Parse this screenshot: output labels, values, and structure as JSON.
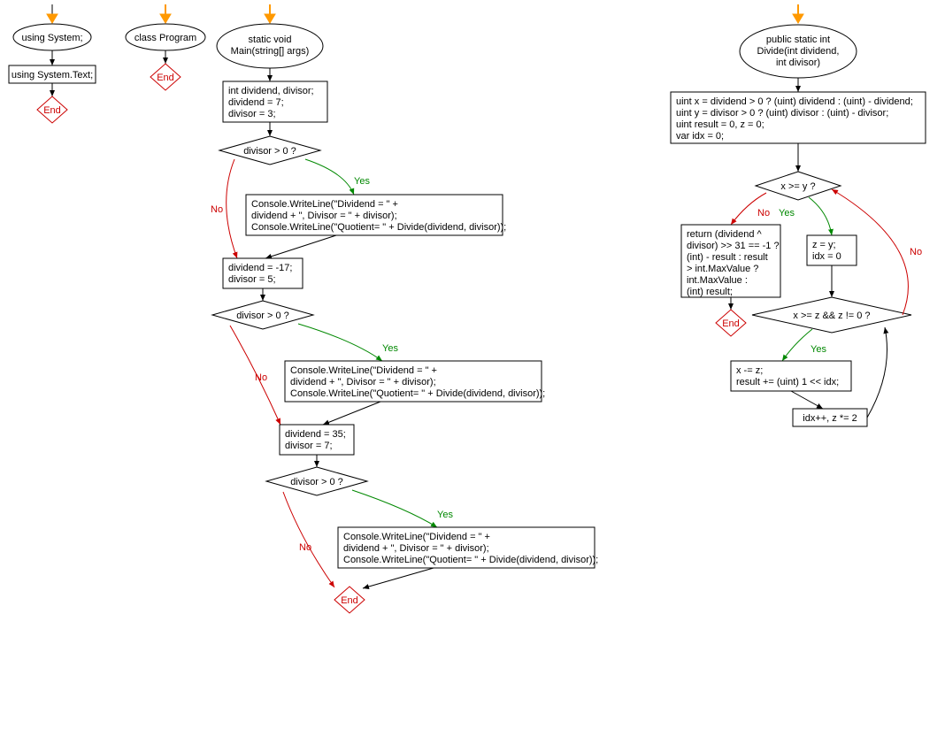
{
  "flowchart1": {
    "start1": "using System;",
    "box1": "using System.Text;",
    "end1": "End"
  },
  "flowchart2": {
    "start2": "class Program",
    "end2": "End"
  },
  "flowchart3": {
    "start3a": "static void",
    "start3b": "Main(string[] args)",
    "block1a": "int dividend, divisor;",
    "block1b": "dividend = 7;",
    "block1c": "divisor = 3;",
    "cond1": "divisor > 0 ?",
    "yes1": "Yes",
    "no1": "No",
    "print1a": "Console.WriteLine(\"Dividend = \" +",
    "print1b": "dividend + \", Divisor = \" + divisor);",
    "print1c": "Console.WriteLine(\"Quotient= \" + Divide(dividend, divisor));",
    "block2a": "dividend = -17;",
    "block2b": "divisor = 5;",
    "cond2": "divisor > 0 ?",
    "yes2": "Yes",
    "no2": "No",
    "print2a": "Console.WriteLine(\"Dividend = \" +",
    "print2b": "dividend + \", Divisor = \" + divisor);",
    "print2c": "Console.WriteLine(\"Quotient= \" + Divide(dividend, divisor));",
    "block3a": "dividend = 35;",
    "block3b": "divisor = 7;",
    "cond3": "divisor > 0 ?",
    "yes3": "Yes",
    "no3": "No",
    "print3a": "Console.WriteLine(\"Dividend = \" +",
    "print3b": "dividend + \", Divisor = \" + divisor);",
    "print3c": "Console.WriteLine(\"Quotient= \" + Divide(dividend, divisor));",
    "end3": "End"
  },
  "flowchart4": {
    "start4a": "public static int",
    "start4b": "Divide(int dividend,",
    "start4c": "int divisor)",
    "block4a": "uint x = dividend > 0 ? (uint) dividend : (uint) - dividend;",
    "block4b": "uint y = divisor > 0 ? (uint) divisor : (uint) - divisor;",
    "block4c": "uint result = 0, z = 0;",
    "block4d": "var idx = 0;",
    "cond4a": "x >= y ?",
    "yes4a": "Yes",
    "no4a": "No",
    "return4a": "return (dividend ^",
    "return4b": "divisor) >> 31 == -1 ?",
    "return4c": "(int) - result : result",
    "return4d": "> int.MaxValue ?",
    "return4e": "int.MaxValue :",
    "return4f": "(int) result;",
    "block5a": "z = y;",
    "block5b": "idx = 0",
    "cond4b": "x >= z && z != 0 ?",
    "yes4b": "Yes",
    "no4b": "No",
    "block6a": "x -= z;",
    "block6b": "result += (uint) 1 << idx;",
    "block7": "idx++, z *= 2",
    "end4": "End"
  },
  "colors": {
    "start_arrow": "#f90",
    "yes_edge": "#080",
    "no_edge": "#c00",
    "end_node": "#c00"
  }
}
